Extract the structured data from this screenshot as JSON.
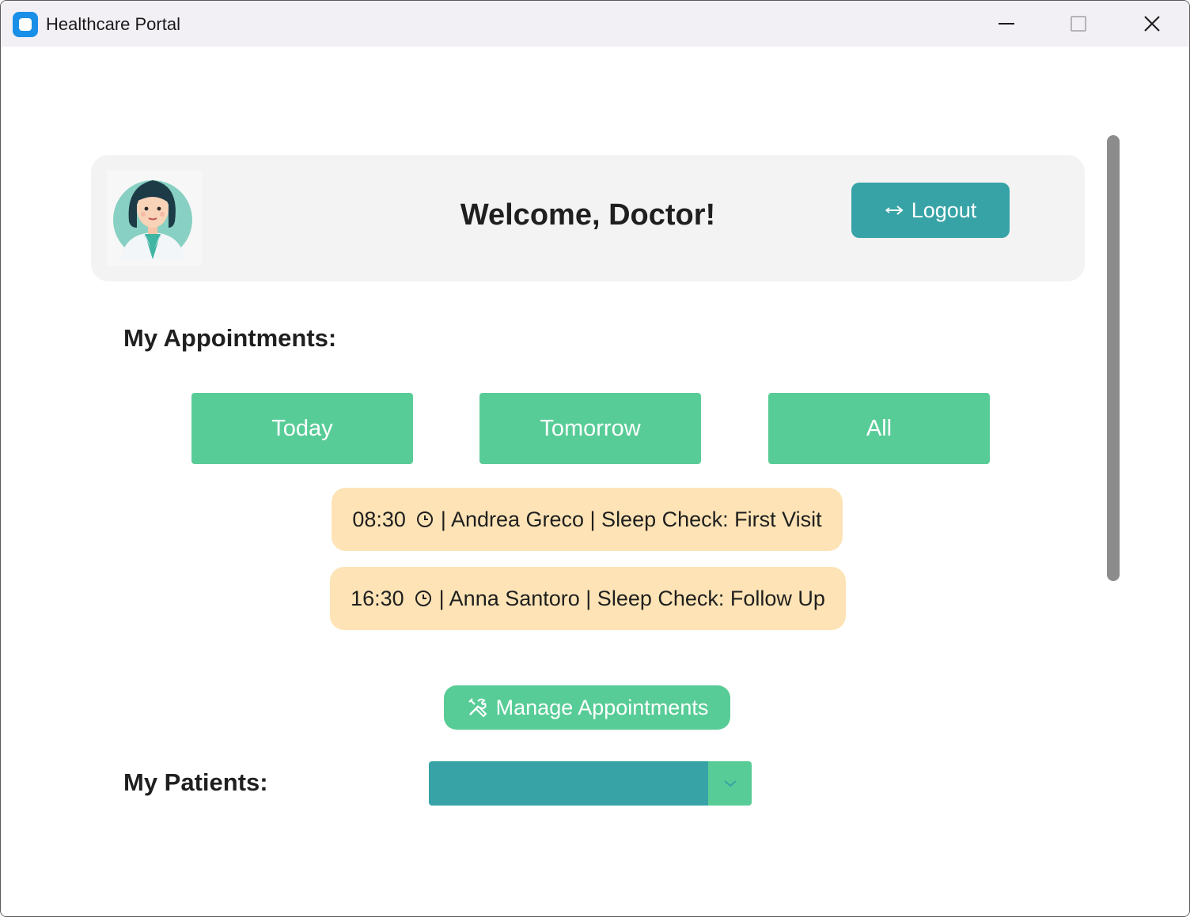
{
  "window": {
    "title": "Healthcare Portal"
  },
  "header": {
    "welcome": "Welcome, Doctor!",
    "logout_label": "Logout",
    "logout_icon": "→"
  },
  "appointments": {
    "label": "My Appointments:",
    "filters": [
      "Today",
      "Tomorrow",
      "All"
    ],
    "items": [
      {
        "time": "08:30",
        "details": "| Andrea Greco | Sleep Check: First Visit"
      },
      {
        "time": "16:30",
        "details": "| Anna Santoro | Sleep Check: Follow Up"
      }
    ],
    "manage_label": "Manage Appointments"
  },
  "patients": {
    "label": "My Patients:",
    "selected": ""
  },
  "colors": {
    "teal": "#37a3a6",
    "green": "#58cc97",
    "appointment_bg": "#fde3b5",
    "card_bg": "#f3f3f3"
  },
  "icons": {
    "app": "app-icon",
    "logout": "arrow-right-icon",
    "clock": "clock-icon",
    "manage": "tools-icon",
    "dropdown": "chevron-down-icon"
  }
}
